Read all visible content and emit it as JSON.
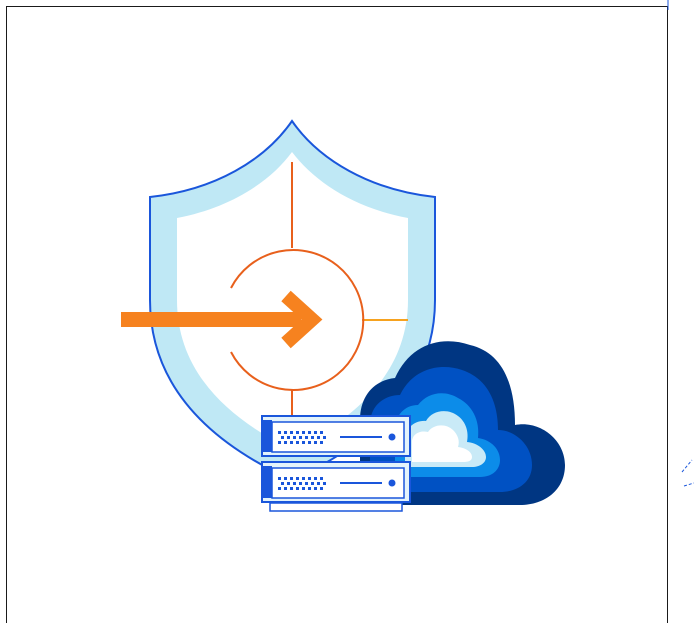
{
  "illustration": {
    "icons": [
      "shield-icon",
      "arrow-right-icon",
      "target-circle-icon",
      "server-rack-icon",
      "cloud-icon"
    ],
    "colors": {
      "shield_outline": "#1a56db",
      "shield_fill": "#bfe8f5",
      "arrow": "#f6821f",
      "target_ring": "#e8601c",
      "cloud_dark": "#003682",
      "cloud_mid": "#0051c3",
      "cloud_light_blue": "#0c8ce9",
      "cloud_pale": "#c9eaf7",
      "server_face": "#e3f3fb",
      "server_outline": "#1a56db"
    }
  }
}
